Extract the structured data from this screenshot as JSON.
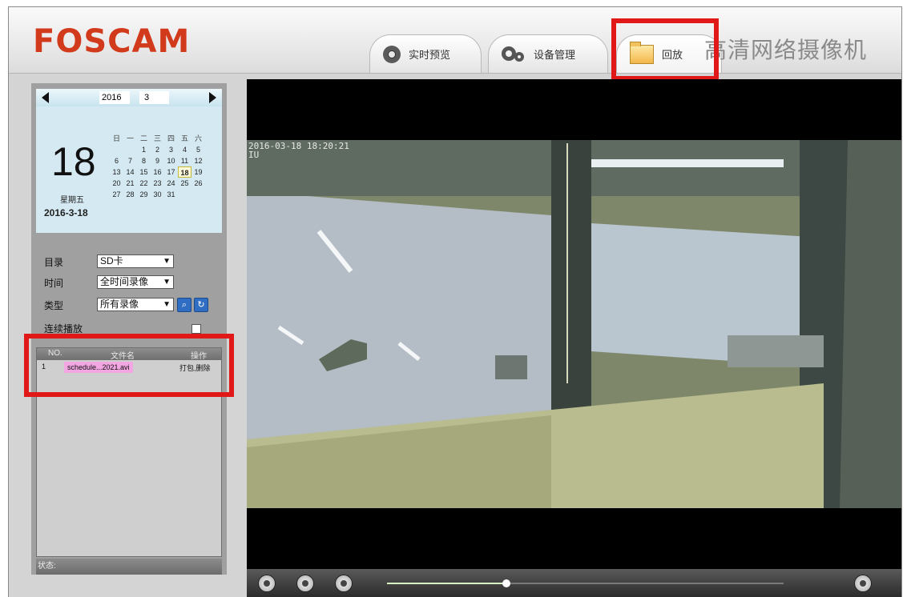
{
  "header": {
    "logo": "FOSCAM",
    "title": "高清网络摄像机",
    "tabs": [
      {
        "label": "实时预览",
        "icon": "webcam-icon"
      },
      {
        "label": "设备管理",
        "icon": "gears-icon"
      },
      {
        "label": "回放",
        "icon": "folder-icon"
      }
    ]
  },
  "calendar": {
    "year": "2016",
    "month": "3",
    "weekday_headers": [
      "日",
      "一",
      "二",
      "三",
      "四",
      "五",
      "六"
    ],
    "weeks": [
      [
        "",
        "",
        "1",
        "2",
        "3",
        "4",
        "5"
      ],
      [
        "6",
        "7",
        "8",
        "9",
        "10",
        "11",
        "12"
      ],
      [
        "13",
        "14",
        "15",
        "16",
        "17",
        "18",
        "19"
      ],
      [
        "20",
        "21",
        "22",
        "23",
        "24",
        "25",
        "26"
      ],
      [
        "27",
        "28",
        "29",
        "30",
        "31",
        "",
        ""
      ]
    ],
    "selected_day": "18",
    "weekday_label": "星期五",
    "full_date": "2016-3-18"
  },
  "filters": {
    "target_label": "目录",
    "target_value": "SD卡",
    "time_label": "时间",
    "time_value": "全时间录像",
    "type_label": "类型",
    "type_value": "所有录像",
    "continuous_label": "连续播放"
  },
  "file_list": {
    "headers": [
      "NO.",
      "文件名",
      "操作"
    ],
    "rows": [
      {
        "no": "1",
        "name": "schedule...2021.avi",
        "action": "打包,删除"
      }
    ]
  },
  "status": {
    "text": "状态:"
  },
  "video": {
    "timestamp": "2016-03-18 18:20:21",
    "osd_line2": "IU",
    "progress": 0.3
  },
  "colors": {
    "logo": "#d23a1c",
    "highlight": "#e01818",
    "file_highlight": "#f2a6e2",
    "calendar_bg": "#d4e9f1"
  }
}
